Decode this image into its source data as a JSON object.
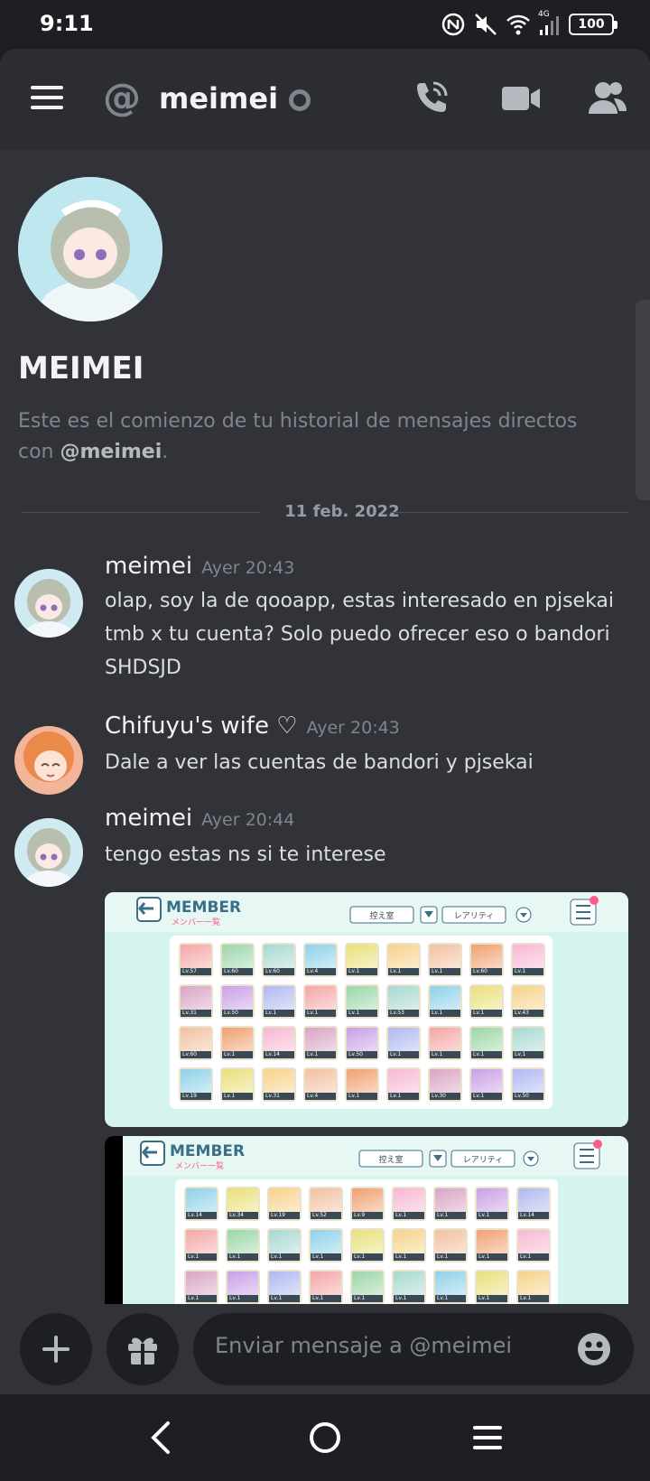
{
  "status_bar": {
    "time": "9:11",
    "network": "4G",
    "battery": "100"
  },
  "header": {
    "at_symbol": "@",
    "username": "meimei",
    "icons": [
      "menu-icon",
      "phone-call-icon",
      "video-camera-icon",
      "members-icon"
    ]
  },
  "intro": {
    "title": "MEIMEI",
    "text_prefix": "Este es el comienzo de tu historial de mensajes directos con ",
    "mention": "@meimei",
    "text_suffix": "."
  },
  "date_divider": "11 feb. 2022",
  "messages": [
    {
      "author": "meimei",
      "time": "Ayer 20:43",
      "text": "olap, soy la de qooapp, estas interesado en pjsekai tmb x tu cuenta? Solo puedo ofrecer eso o bandori SHDSJD"
    },
    {
      "author": "Chifuyu's wife ♡",
      "time": "Ayer 20:43",
      "text": "Dale a ver las cuentas de bandori y pjsekai"
    },
    {
      "author": "meimei",
      "time": "Ayer 20:44",
      "text": "tengo estas ns si te interese"
    }
  ],
  "attachments": [
    {
      "title": "MEMBER",
      "subtitle": "メンバー一覧",
      "btn1": "控え室",
      "btn2": "レアリティ",
      "levels": [
        "Lv.57",
        "Lv.60",
        "Lv.60",
        "Lv.4",
        "Lv.1",
        "Lv.1",
        "Lv.1",
        "Lv.60",
        "Lv.1",
        "Lv.31",
        "Lv.50",
        "Lv.1",
        "Lv.1",
        "Lv.1",
        "Lv.53",
        "Lv.1",
        "Lv.1",
        "Lv.43",
        "Lv.60",
        "Lv.1",
        "Lv.14",
        "Lv.1",
        "Lv.50",
        "Lv.1",
        "Lv.1",
        "Lv.1",
        "Lv.1",
        "Lv.19",
        "Lv.1",
        "Lv.31",
        "Lv.4",
        "Lv.1",
        "Lv.1",
        "Lv.30",
        "Lv.1",
        "Lv.50"
      ]
    },
    {
      "title": "MEMBER",
      "subtitle": "メンバー一覧",
      "btn1": "控え室",
      "btn2": "レアリティ",
      "levels": [
        "Lv.14",
        "Lv.34",
        "Lv.19",
        "Lv.52",
        "Lv.9",
        "Lv.1",
        "Lv.1",
        "Lv.1",
        "Lv.14",
        "Lv.1",
        "Lv.1",
        "Lv.1",
        "Lv.1",
        "Lv.1",
        "Lv.1",
        "Lv.1",
        "Lv.1",
        "Lv.1",
        "Lv.1",
        "Lv.1",
        "Lv.1",
        "Lv.1",
        "Lv.1",
        "Lv.1",
        "Lv.1",
        "Lv.1",
        "Lv.1"
      ]
    }
  ],
  "composer": {
    "placeholder": "Enviar mensaje a @meimei"
  },
  "colors": {
    "background": "#313338",
    "header": "#2b2d31",
    "text_muted": "#80848e",
    "text_normal": "#dbdee1"
  }
}
